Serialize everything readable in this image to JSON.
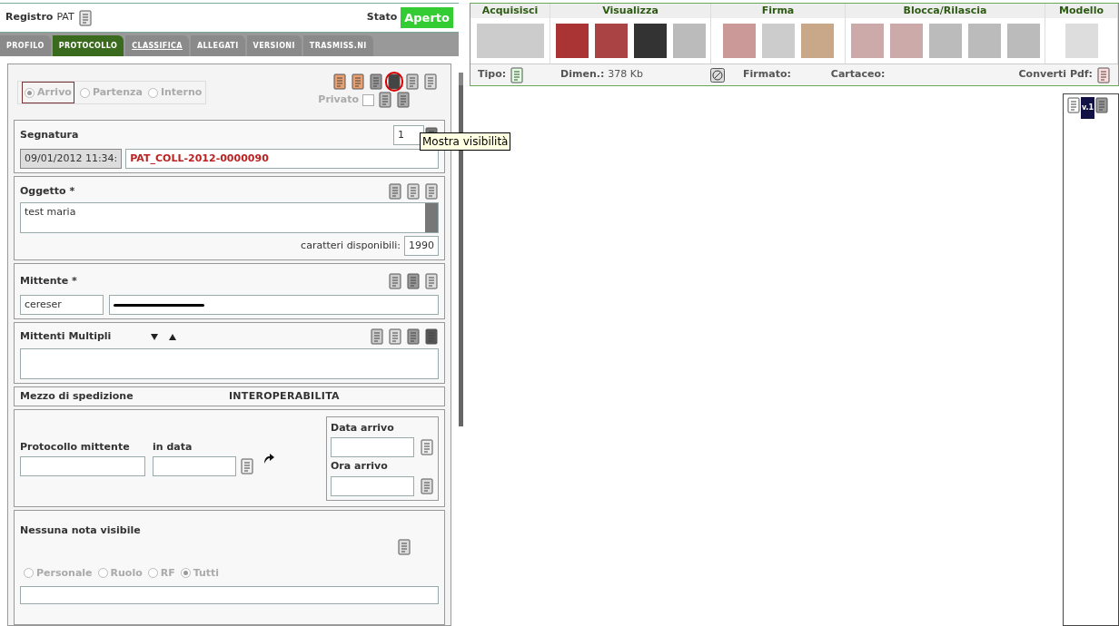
{
  "header": {
    "registro_label": "Registro",
    "registro_value": "PAT",
    "stato_label": "Stato",
    "stato_value": "Aperto"
  },
  "tabs": [
    {
      "label": "PROFILO",
      "selected": false
    },
    {
      "label": "PROTOCOLLO",
      "selected": true
    },
    {
      "label": "CLASSIFICA",
      "selected": false
    },
    {
      "label": "ALLEGATI",
      "selected": false
    },
    {
      "label": "VERSIONI",
      "selected": false
    },
    {
      "label": "TRASMISS.NI",
      "selected": false
    }
  ],
  "direction": [
    {
      "label": "Arrivo",
      "selected": true
    },
    {
      "label": "Partenza",
      "selected": false
    },
    {
      "label": "Interno",
      "selected": false
    }
  ],
  "privato": {
    "label": "Privato",
    "checked": false
  },
  "tooltip": "Mostra visibilità",
  "segnatura": {
    "label": "Segnatura",
    "copies": "1",
    "date": "09/01/2012 11:34:",
    "number": "PAT_COLL-2012-0000090"
  },
  "oggetto": {
    "label": "Oggetto *",
    "value": "test maria",
    "chars_label": "caratteri disponibili:",
    "chars": "1990"
  },
  "mittente": {
    "label": "Mittente *",
    "code": "cereser"
  },
  "mittenti_multipli": {
    "label": "Mittenti Multipli"
  },
  "mezzo": {
    "label": "Mezzo di spedizione",
    "value": "INTEROPERABILITA"
  },
  "protocollo": {
    "mittente_label": "Protocollo mittente",
    "in_data_label": "in data",
    "data_arrivo_label": "Data arrivo",
    "ora_arrivo_label": "Ora arrivo"
  },
  "note": {
    "label": "Nessuna nota visibile",
    "visibility": [
      {
        "label": "Personale",
        "selected": false
      },
      {
        "label": "Ruolo",
        "selected": false
      },
      {
        "label": "RF",
        "selected": false
      },
      {
        "label": "Tutti",
        "selected": true
      }
    ]
  },
  "toolbar": [
    {
      "label": "Acquisisci"
    },
    {
      "label": "Visualizza"
    },
    {
      "label": "Firma"
    },
    {
      "label": "Blocca/Rilascia"
    },
    {
      "label": "Modello"
    }
  ],
  "info_bar": {
    "tipo": "Tipo:",
    "dimen_label": "Dimen.:",
    "dimen_value": "378 Kb",
    "firmato": "Firmato:",
    "cartaceo": "Cartaceo:",
    "converti": "Converti Pdf:"
  },
  "viewer": {
    "version": "v.1"
  }
}
